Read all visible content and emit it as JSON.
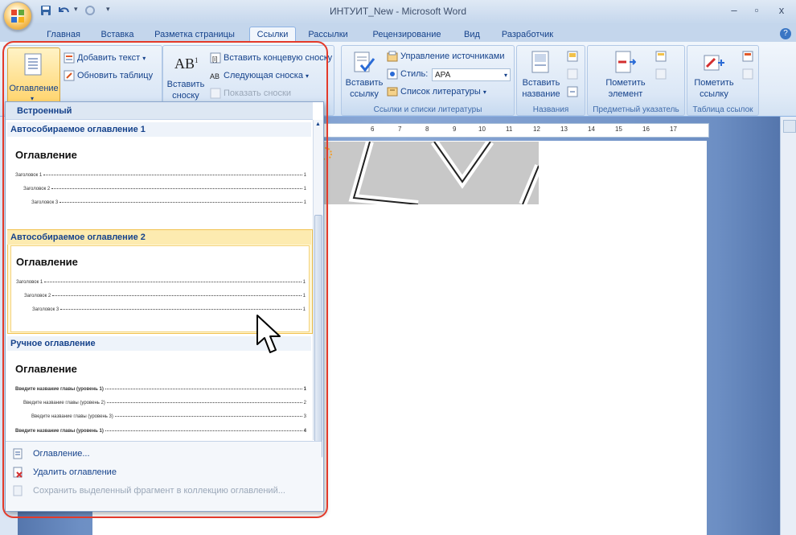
{
  "window": {
    "title": "ИНТУИТ_New - Microsoft Word",
    "controls": [
      "–",
      "▫",
      "x"
    ]
  },
  "tabs": [
    "Главная",
    "Вставка",
    "Разметка страницы",
    "Ссылки",
    "Рассылки",
    "Рецензирование",
    "Вид",
    "Разработчик"
  ],
  "active_tab": "Ссылки",
  "ribbon": {
    "toc_group": {
      "big_button": "Оглавление",
      "add_text": "Добавить текст",
      "update_table": "Обновить таблицу"
    },
    "footnotes_group": {
      "insert_footnote_line1": "Вставить",
      "insert_footnote_line2": "сноску",
      "insert_endnote": "Вставить концевую сноску",
      "next_footnote": "Следующая сноска",
      "show_notes": "Показать сноски"
    },
    "citations_group": {
      "insert_citation_line1": "Вставить",
      "insert_citation_line2": "ссылку",
      "manage_sources": "Управление источниками",
      "style_label": "Стиль:",
      "style_value": "APA",
      "bibliography": "Список литературы",
      "label": "Ссылки и списки литературы"
    },
    "captions_group": {
      "insert_caption_line1": "Вставить",
      "insert_caption_line2": "название",
      "label": "Названия"
    },
    "index_group": {
      "mark_entry_line1": "Пометить",
      "mark_entry_line2": "элемент",
      "label": "Предметный указатель"
    },
    "authorities_group": {
      "mark_citation_line1": "Пометить",
      "mark_citation_line2": "ссылку",
      "label": "Таблица ссылок"
    }
  },
  "ruler": {
    "ticks": [
      "6",
      "7",
      "8",
      "9",
      "10",
      "11",
      "12",
      "13",
      "14",
      "15",
      "16",
      "17"
    ]
  },
  "gallery": {
    "header": "Встроенный",
    "items": [
      {
        "title": "Автособираемое оглавление 1",
        "toc_title": "Оглавление",
        "lines": [
          {
            "text": "Заголовок 1",
            "page": "1"
          },
          {
            "text": "Заголовок 2",
            "page": "1"
          },
          {
            "text": "Заголовок 3",
            "page": "1"
          }
        ]
      },
      {
        "title": "Автособираемое оглавление 2",
        "toc_title": "Оглавление",
        "lines": [
          {
            "text": "Заголовок 1",
            "page": "1"
          },
          {
            "text": "Заголовок 2",
            "page": "1"
          },
          {
            "text": "Заголовок 3",
            "page": "1"
          }
        ]
      },
      {
        "title": "Ручное оглавление",
        "toc_title": "Оглавление",
        "lines": [
          {
            "text": "Введите название главы (уровень 1)",
            "page": "1"
          },
          {
            "text": "Введите название главы (уровень 2)",
            "page": "2"
          },
          {
            "text": "Введите название главы (уровень 3)",
            "page": "3"
          },
          {
            "text": "Введите название главы (уровень 1)",
            "page": "4"
          }
        ]
      }
    ],
    "menu": {
      "toc_dialog": "Оглавление...",
      "remove_toc": "Удалить оглавление",
      "save_selection": "Сохранить выделенный фрагмент в коллекцию оглавлений..."
    }
  },
  "colors": {
    "accent": "#15428b",
    "highlight_border": "#e33a2a",
    "hover_item": "#fff3c6"
  }
}
